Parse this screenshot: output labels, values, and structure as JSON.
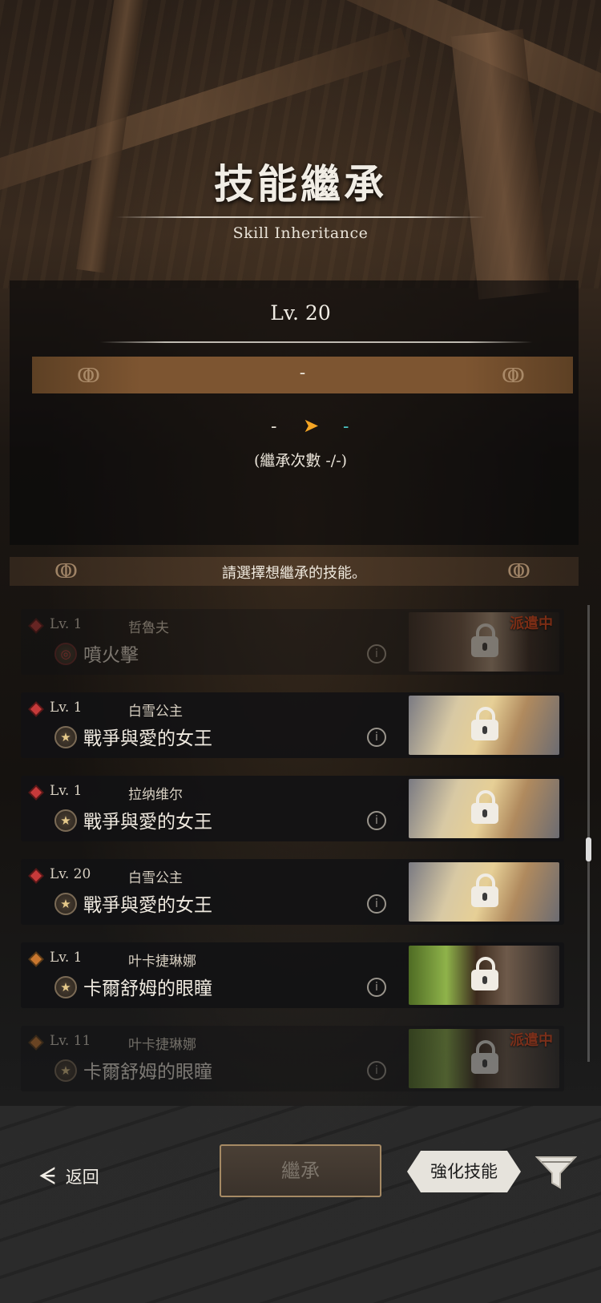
{
  "header": {
    "title": "技能繼承",
    "subtitle": "Skill Inheritance"
  },
  "target": {
    "level": "Lv.  20",
    "skill_name": "-",
    "transfer_from": "-",
    "transfer_to": "-",
    "count_text": "(繼承次數 -/-)"
  },
  "prompt": "請選擇想繼承的技能。",
  "skills": [
    {
      "level": "Lv. 1",
      "owner": "哲魯夫",
      "skill": "噴火擊",
      "status": "派遣中",
      "icon": "fire-target-icon",
      "gem": "red",
      "thumb": "dark",
      "dimmed": true
    },
    {
      "level": "Lv. 1",
      "owner": "白雪公主",
      "skill": "戰爭與愛的女王",
      "status": "",
      "icon": "star-icon",
      "gem": "red",
      "thumb": "blonde",
      "dimmed": false
    },
    {
      "level": "Lv. 1",
      "owner": "拉纳维尔",
      "skill": "戰爭與愛的女王",
      "status": "",
      "icon": "star-icon",
      "gem": "red",
      "thumb": "blonde",
      "dimmed": false
    },
    {
      "level": "Lv. 20",
      "owner": "白雪公主",
      "skill": "戰爭與愛的女王",
      "status": "",
      "icon": "star-icon",
      "gem": "red",
      "thumb": "blonde",
      "dimmed": false
    },
    {
      "level": "Lv. 1",
      "owner": "叶卡捷琳娜",
      "skill": "卡爾舒姆的眼瞳",
      "status": "",
      "icon": "star-icon",
      "gem": "orange",
      "thumb": "green",
      "dimmed": false
    },
    {
      "level": "Lv. 11",
      "owner": "叶卡捷琳娜",
      "skill": "卡爾舒姆的眼瞳",
      "status": "派遣中",
      "icon": "star-icon",
      "gem": "orange",
      "thumb": "green",
      "dimmed": true
    }
  ],
  "footer": {
    "back_label": "返回",
    "inherit_label": "繼承",
    "enhance_label": "強化技能"
  },
  "colors": {
    "dispatch_status": "#f04a1a",
    "arrow_accent": "#f5a524",
    "target_value": "#4bc6c6"
  }
}
